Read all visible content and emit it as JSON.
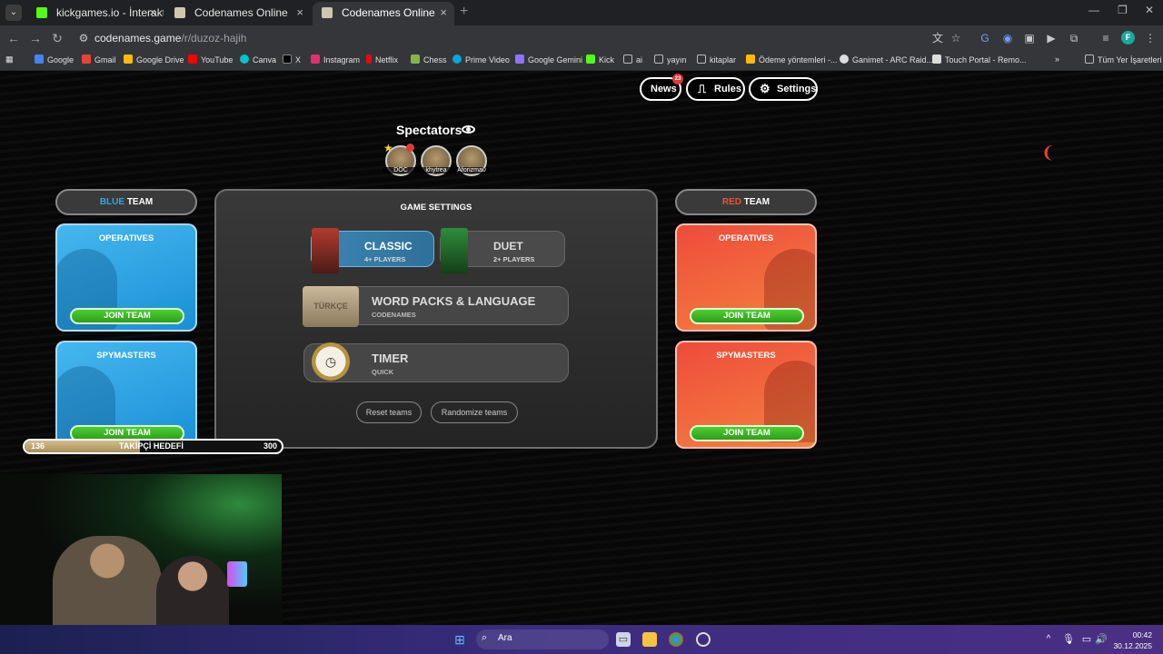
{
  "browser": {
    "tabs": [
      {
        "title": "kickgames.io - İnteraktif Chat O",
        "close": "×",
        "fav_color": "#53fc18"
      },
      {
        "title": "Codenames Online",
        "close": "×",
        "fav_color": "#d0c6b0"
      },
      {
        "title": "Codenames Online",
        "close": "×",
        "fav_color": "#d0c6b0"
      }
    ],
    "tab_add": "+",
    "url_host": "codenames.game",
    "url_path": "/r/duzoz-hajih",
    "profile_initial": "F",
    "bookmarks": [
      {
        "label": "Google",
        "color": "#4285f4"
      },
      {
        "label": "Gmail",
        "color": "#ea4335"
      },
      {
        "label": "Google Drive",
        "color": "#fbbc04"
      },
      {
        "label": "YouTube",
        "color": "#ff0000"
      },
      {
        "label": "Canva",
        "color": "#00c4cc"
      },
      {
        "label": "X",
        "color": "#000000"
      },
      {
        "label": "Instagram",
        "color": "#e1306c"
      },
      {
        "label": "Netflix",
        "color": "#e50914"
      },
      {
        "label": "Chess",
        "color": "#81b64c"
      },
      {
        "label": "Prime Video",
        "color": "#00a8e1"
      },
      {
        "label": "Google Gemini",
        "color": "#8e75ff"
      },
      {
        "label": "Kick",
        "color": "#53fc18"
      },
      {
        "label": "ai",
        "color": "#9aa0a6"
      },
      {
        "label": "yayın",
        "color": "#9aa0a6"
      },
      {
        "label": "kitaplar",
        "color": "#9aa0a6"
      },
      {
        "label": "Ödeme yöntemleri -...",
        "color": "#fbbc04"
      },
      {
        "label": "Ganimet - ARC Raid...",
        "color": "#ddd"
      },
      {
        "label": "Touch Portal - Remo...",
        "color": "#ddd"
      }
    ],
    "bookmarks_overflow": "»",
    "all_bookmarks": "Tüm Yer İşaretleri"
  },
  "top_nav": {
    "news": "News",
    "news_badge": "23",
    "rules": "Rules",
    "settings": "Settings"
  },
  "spectators": {
    "title": "Spectators",
    "users": [
      "DOC",
      "khytrea",
      "Aforizma0"
    ]
  },
  "blue_team": {
    "color_word": "BLUE",
    "team_word": "TEAM",
    "operatives": "OPERATIVES",
    "spymasters": "SPYMASTERS",
    "join": "JOIN TEAM"
  },
  "red_team": {
    "color_word": "RED",
    "team_word": "TEAM",
    "operatives": "OPERATIVES",
    "spymasters": "SPYMASTERS",
    "join": "JOIN TEAM"
  },
  "game_settings": {
    "title": "GAME SETTINGS",
    "classic": {
      "title": "CLASSIC",
      "sub": "4+ PLAYERS"
    },
    "duet": {
      "title": "DUET",
      "sub": "2+ PLAYERS"
    },
    "word_packs": {
      "title": "WORD PACKS & LANGUAGE",
      "sub": "CODENAMES",
      "box_label": "TÜRKÇE"
    },
    "timer": {
      "title": "TIMER",
      "sub": "QUICK"
    },
    "reset": "Reset teams",
    "randomize": "Randomize teams"
  },
  "overlay_goal": {
    "current": "136",
    "label": "TAKİPÇİ HEDEFİ",
    "target": "300",
    "progress_fraction": 0.45
  },
  "taskbar": {
    "search": "Ara",
    "time": "00:42",
    "date": "30.12.2025"
  },
  "colors": {
    "blue_accent": "#2ea7ea",
    "red_accent": "#f04e3b",
    "join_green": "#3dbb24"
  }
}
